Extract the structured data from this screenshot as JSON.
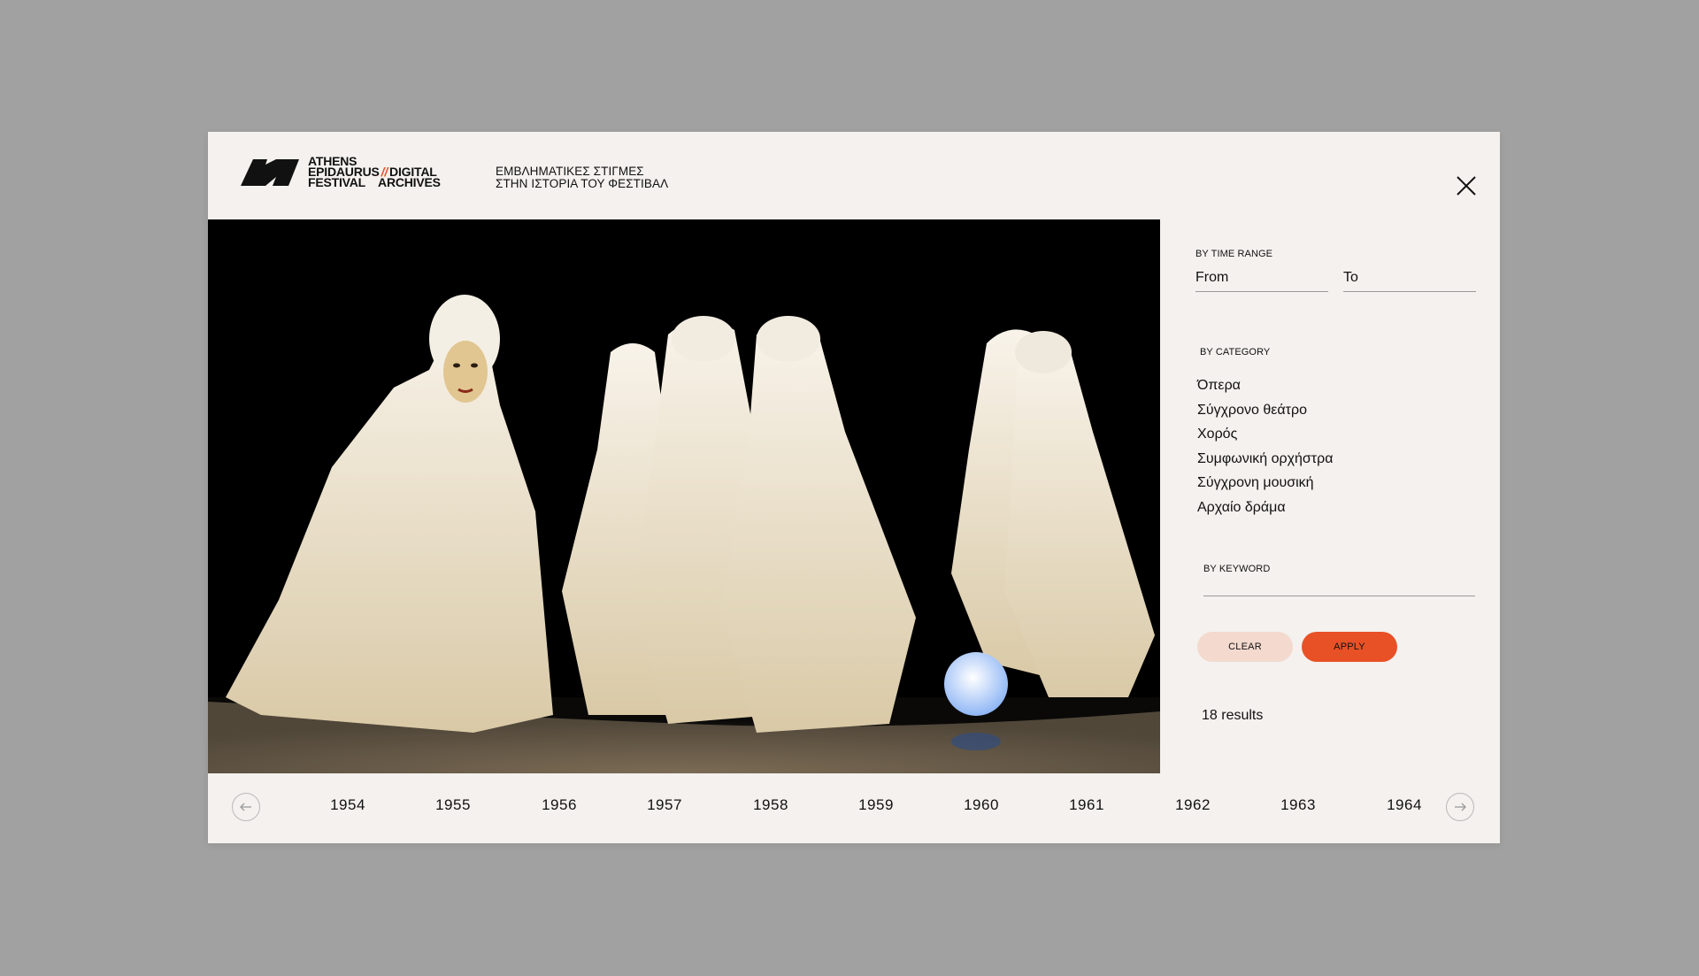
{
  "header": {
    "logo": {
      "line1": "ATHENS",
      "line2": "EPIDAURUS",
      "line3": "FESTIVAL",
      "slash": "//",
      "line2b": "DIGITAL",
      "line3b": "ARCHIVES"
    },
    "tagline_line1": "ΕΜΒΛΗΜΑΤΙΚΕΣ ΣΤΙΓΜΕΣ",
    "tagline_line2": "ΣΤΗΝ ΙΣΤΟΡΙΑ ΤΟΥ ΦΕΣΤΙΒΑΛ",
    "close_icon": "close-icon"
  },
  "photo": {
    "kind": "performance photograph: masked performer and figures in white hooded robes on dark stage"
  },
  "filters": {
    "time_range_label": "BY TIME RANGE",
    "from_placeholder": "From",
    "to_placeholder": "To",
    "category_label": "BY CATEGORY",
    "categories": [
      "Όπερα",
      "Σύγχρονο θεάτρο",
      "Χορός",
      "Συμφωνική ορχήστρα",
      "Σύγχρονη μουσική",
      "Αρχαίο δράμα"
    ],
    "keyword_label": "BY KEYWORD",
    "clear_label": "CLEAR",
    "apply_label": "APPLY",
    "results_text": "18 results"
  },
  "timeline": {
    "years": [
      "1954",
      "1955",
      "1956",
      "1957",
      "1958",
      "1959",
      "1960",
      "1961",
      "1962",
      "1963",
      "1964"
    ],
    "prev_icon": "arrow-left-icon",
    "next_icon": "arrow-right-icon"
  },
  "colors": {
    "page_background": "#a1a1a1",
    "modal_background": "#f4f1ee",
    "accent": "#e85126",
    "clear_button": "#f3d9ce"
  }
}
